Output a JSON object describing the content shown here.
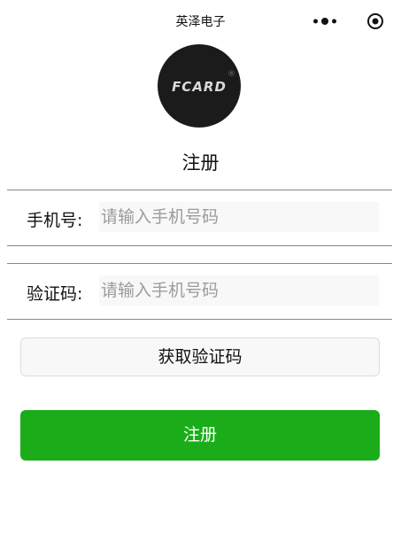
{
  "nav": {
    "title": "英泽电子",
    "more_icon": "more-dots-icon",
    "close_icon": "target-close-icon"
  },
  "logo": {
    "text": "FCARD",
    "mark": "®"
  },
  "page": {
    "title": "注册"
  },
  "form": {
    "phone": {
      "label": "手机号:",
      "placeholder": "请输入手机号码",
      "value": ""
    },
    "code": {
      "label": "验证码:",
      "placeholder": "请输入手机号码",
      "value": ""
    }
  },
  "buttons": {
    "get_code": "获取验证码",
    "submit": "注册"
  },
  "colors": {
    "primary": "#1aad19",
    "logo_bg": "#1b1b1b",
    "input_bg": "#f8f8f8",
    "divider": "#888888"
  }
}
